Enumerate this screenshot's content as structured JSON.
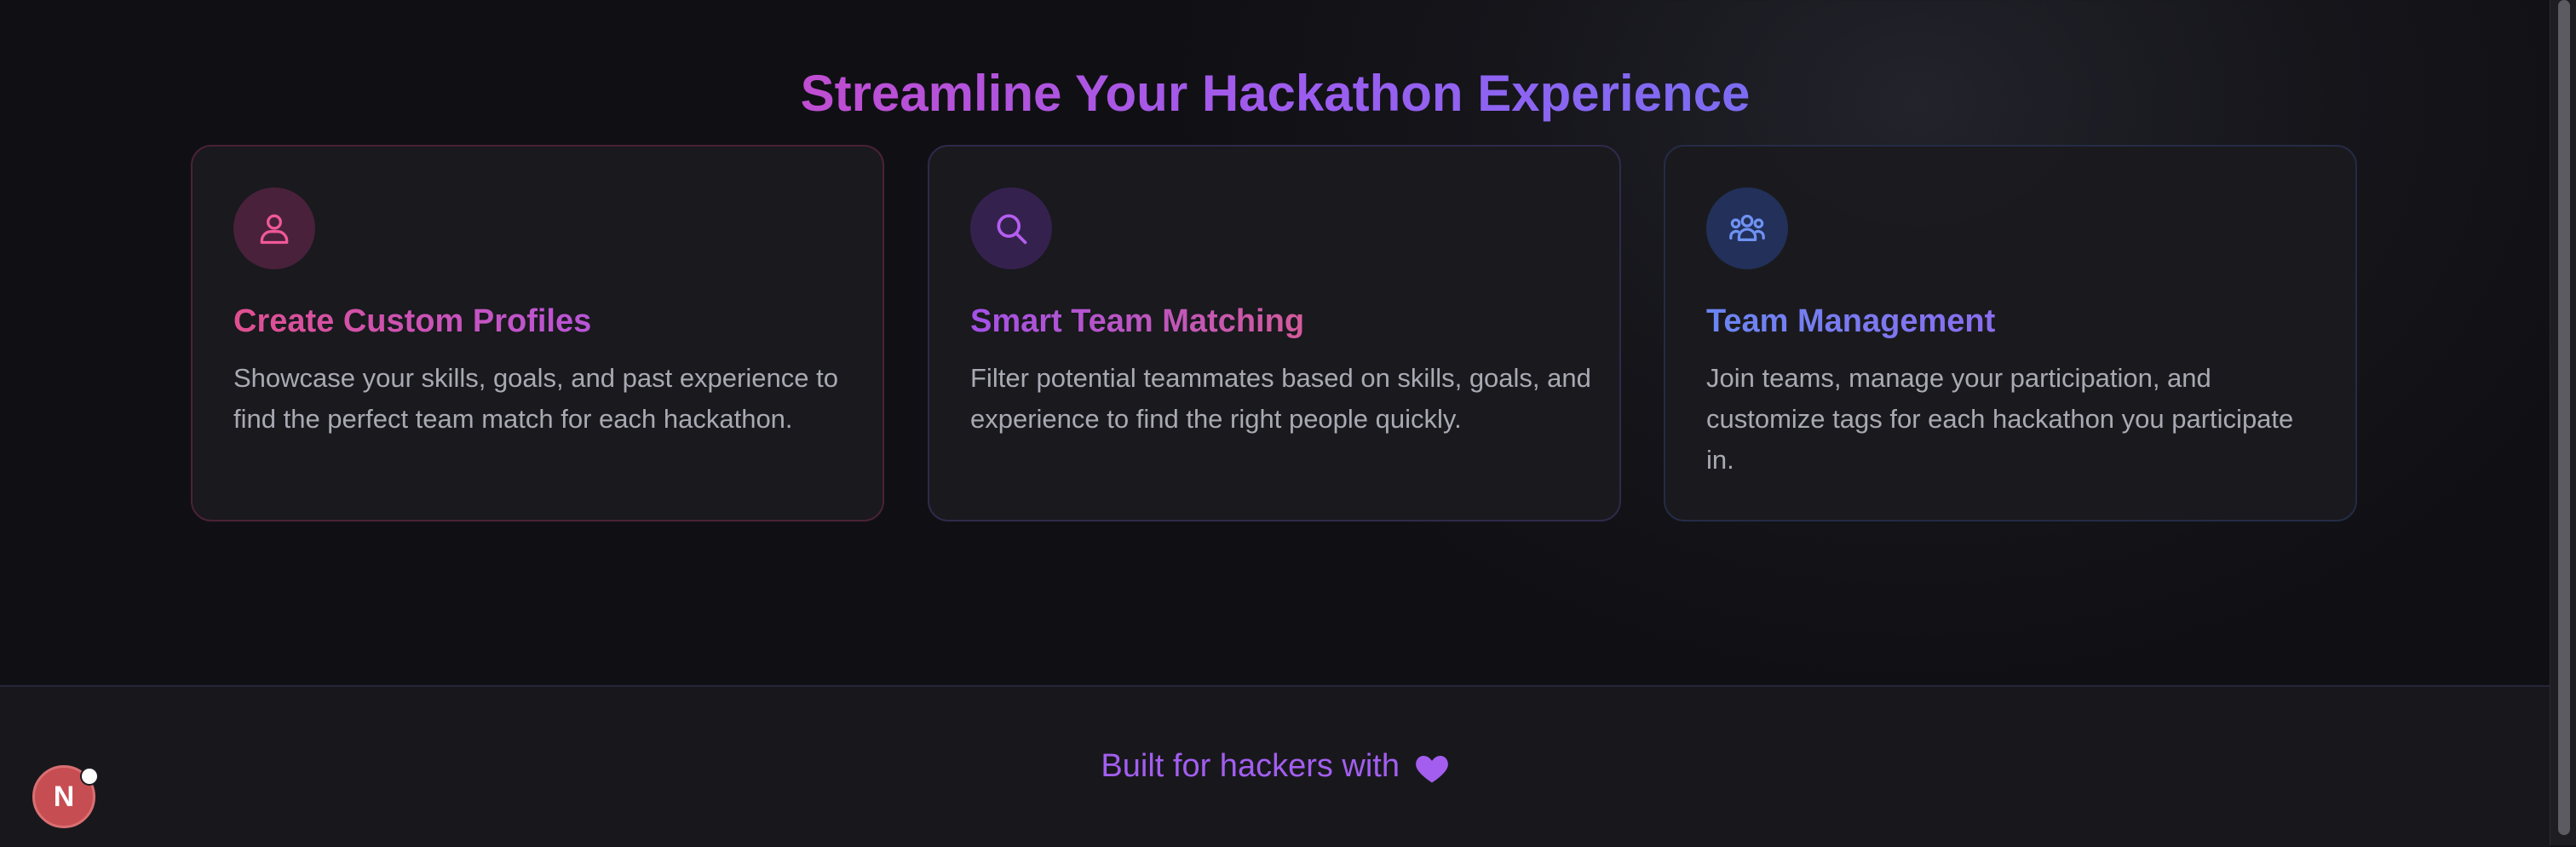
{
  "section": {
    "title": "Streamline Your Hackathon Experience",
    "features": [
      {
        "icon": "user-icon",
        "title": "Create Custom Profiles",
        "description": "Showcase your skills, goals, and past experience to find the perfect team match for each hackathon."
      },
      {
        "icon": "search-icon",
        "title": "Smart Team Matching",
        "description": "Filter potential teammates based on skills, goals, and experience to find the right people quickly."
      },
      {
        "icon": "users-icon",
        "title": "Team Management",
        "description": "Join teams, manage your participation, and customize tags for each hackathon you participate in."
      }
    ]
  },
  "footer": {
    "text": "Built for hackers with",
    "icon": "heart-icon"
  },
  "dev_badge": {
    "label": "N"
  },
  "colors": {
    "accent_pink": "#e0508f",
    "accent_purple": "#a451e8",
    "accent_blue": "#6a86f2",
    "background": "#15151a"
  }
}
